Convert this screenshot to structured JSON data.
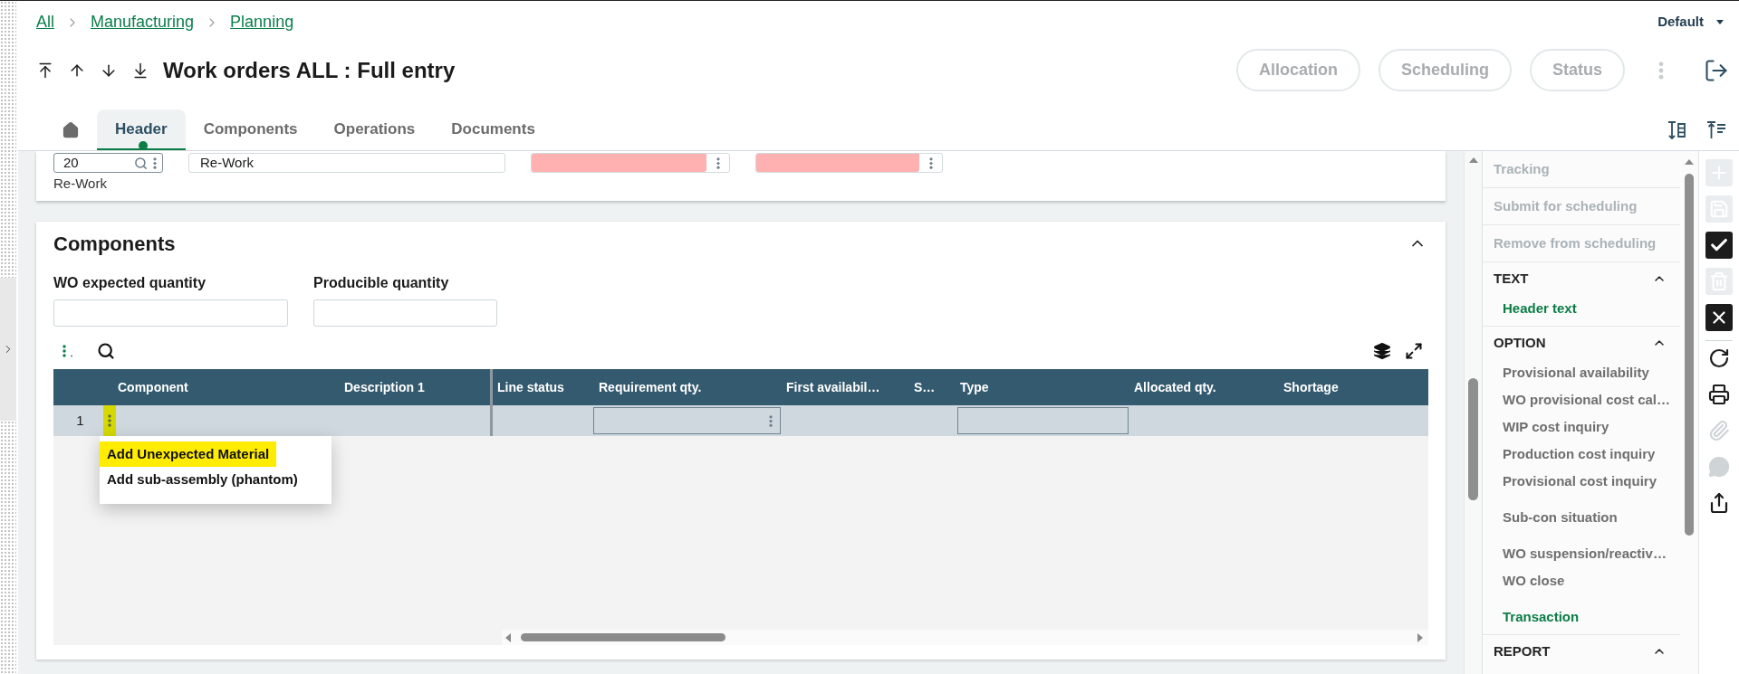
{
  "breadcrumb": [
    {
      "label": "All"
    },
    {
      "label": "Manufacturing"
    },
    {
      "label": "Planning"
    }
  ],
  "view_selector": {
    "label": "Default"
  },
  "title": "Work orders ALL : Full entry",
  "action_buttons": [
    {
      "label": "Allocation",
      "disabled": true
    },
    {
      "label": "Scheduling",
      "disabled": true
    },
    {
      "label": "Status",
      "disabled": true
    }
  ],
  "tabs": [
    {
      "kind": "home",
      "selected": false
    },
    {
      "kind": "tab",
      "label": "Header",
      "selected": true
    },
    {
      "kind": "tab",
      "label": "Components",
      "selected": false
    },
    {
      "kind": "tab",
      "label": "Operations",
      "selected": false
    },
    {
      "kind": "tab",
      "label": "Documents",
      "selected": false
    }
  ],
  "header_card": {
    "fields": [
      {
        "kind": "lookup",
        "value": "20",
        "caption": "Re-Work"
      },
      {
        "kind": "text",
        "value": "Re-Work"
      },
      {
        "kind": "required"
      },
      {
        "kind": "required"
      }
    ]
  },
  "components": {
    "title": "Components",
    "expanded": true,
    "fields": [
      {
        "label": "WO expected quantity"
      },
      {
        "label": "Producible quantity"
      }
    ],
    "table": {
      "columns": [
        {
          "label": "Component",
          "kind": "text"
        },
        {
          "label": "Description 1",
          "kind": "text"
        },
        {
          "label": "Line status",
          "kind": "text"
        },
        {
          "label": "Requirement qty.",
          "kind": "input-menu"
        },
        {
          "label": "First availabil…",
          "kind": "text"
        },
        {
          "label": "S…",
          "kind": "text"
        },
        {
          "label": "Type",
          "kind": "input"
        },
        {
          "label": "Allocated qty.",
          "kind": "text"
        },
        {
          "label": "Shortage",
          "kind": "text"
        }
      ],
      "rows": [
        {
          "number": "1",
          "marker_highlight": true
        }
      ]
    },
    "context_menu": {
      "items": [
        {
          "label": "Add Unexpected Material",
          "marker_highlight": true
        },
        {
          "label": "Add sub-assembly (phantom)",
          "marker_highlight": false
        }
      ]
    }
  },
  "side_panel": {
    "actions": [
      {
        "label": "Tracking",
        "disabled": true
      },
      {
        "label": "Submit for scheduling",
        "disabled": true
      },
      {
        "label": "Remove from scheduling",
        "disabled": true
      }
    ],
    "sections": [
      {
        "title": "TEXT",
        "expanded": true,
        "groups": [
          {
            "items": [
              {
                "label": "Header text",
                "kind": "link"
              }
            ]
          }
        ]
      },
      {
        "title": "OPTION",
        "expanded": true,
        "groups": [
          {
            "items": [
              {
                "label": "Provisional availability",
                "kind": "option"
              },
              {
                "label": "WO provisional cost cal…",
                "kind": "option"
              },
              {
                "label": "WIP cost inquiry",
                "kind": "option"
              },
              {
                "label": "Production cost inquiry",
                "kind": "option"
              },
              {
                "label": "Provisional cost inquiry",
                "kind": "option"
              }
            ]
          },
          {
            "items": [
              {
                "label": "Sub-con situation",
                "kind": "option"
              }
            ]
          },
          {
            "items": [
              {
                "label": "WO suspension/reactiv…",
                "kind": "option"
              },
              {
                "label": "WO close",
                "kind": "option"
              }
            ]
          },
          {
            "items": [
              {
                "label": "Transaction",
                "kind": "link"
              }
            ]
          }
        ]
      },
      {
        "title": "REPORT",
        "expanded": true
      }
    ]
  },
  "record_tools": [
    {
      "kind": "add",
      "disabled": true
    },
    {
      "kind": "save",
      "disabled": true
    },
    {
      "kind": "confirm",
      "disabled": false
    },
    {
      "kind": "delete",
      "disabled": true
    },
    {
      "kind": "cancel",
      "disabled": false
    }
  ],
  "tools": [
    {
      "kind": "refresh",
      "disabled": false
    },
    {
      "kind": "print",
      "disabled": false
    },
    {
      "kind": "attach",
      "disabled": true
    },
    {
      "kind": "comment",
      "disabled": true
    },
    {
      "kind": "export",
      "disabled": false
    }
  ]
}
